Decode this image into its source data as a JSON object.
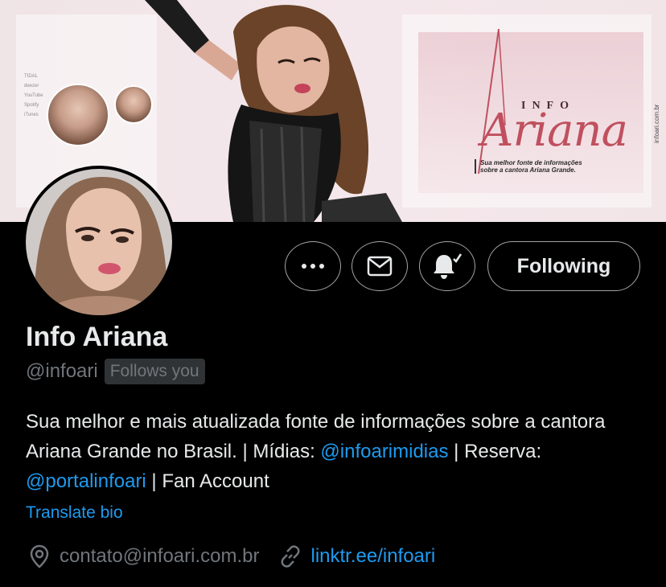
{
  "banner": {
    "platforms": [
      "TIDAL",
      "deezer",
      "YouTube",
      "Spotify",
      "iTunes"
    ],
    "logo_info": "INFO",
    "logo_name": "Ariana",
    "tagline": "Sua melhor fonte de informações sobre a cantora Ariana Grande.",
    "site": "infoari.com.br"
  },
  "actions": {
    "more_icon": "more-horizontal-icon",
    "message_icon": "envelope-icon",
    "notify_icon": "bell-check-icon",
    "follow_label": "Following"
  },
  "profile": {
    "display_name": "Info Ariana",
    "handle": "@infoari",
    "follows_you": "Follows you",
    "bio": {
      "part1": "Sua melhor e mais atualizada fonte de informações sobre a cantora Ariana Grande no Brasil. | Mídias: ",
      "mention1": "@infoarimidias",
      "part2": " | Reserva: ",
      "mention2": "@portalinfoari",
      "part3": " | Fan Account"
    },
    "translate": "Translate bio",
    "location": "contato@infoari.com.br",
    "website": "linktr.ee/infoari"
  },
  "colors": {
    "background": "#000000",
    "text": "#e7e9ea",
    "secondary": "#71767b",
    "link": "#1d9bf0",
    "border": "#a1a5a9"
  }
}
